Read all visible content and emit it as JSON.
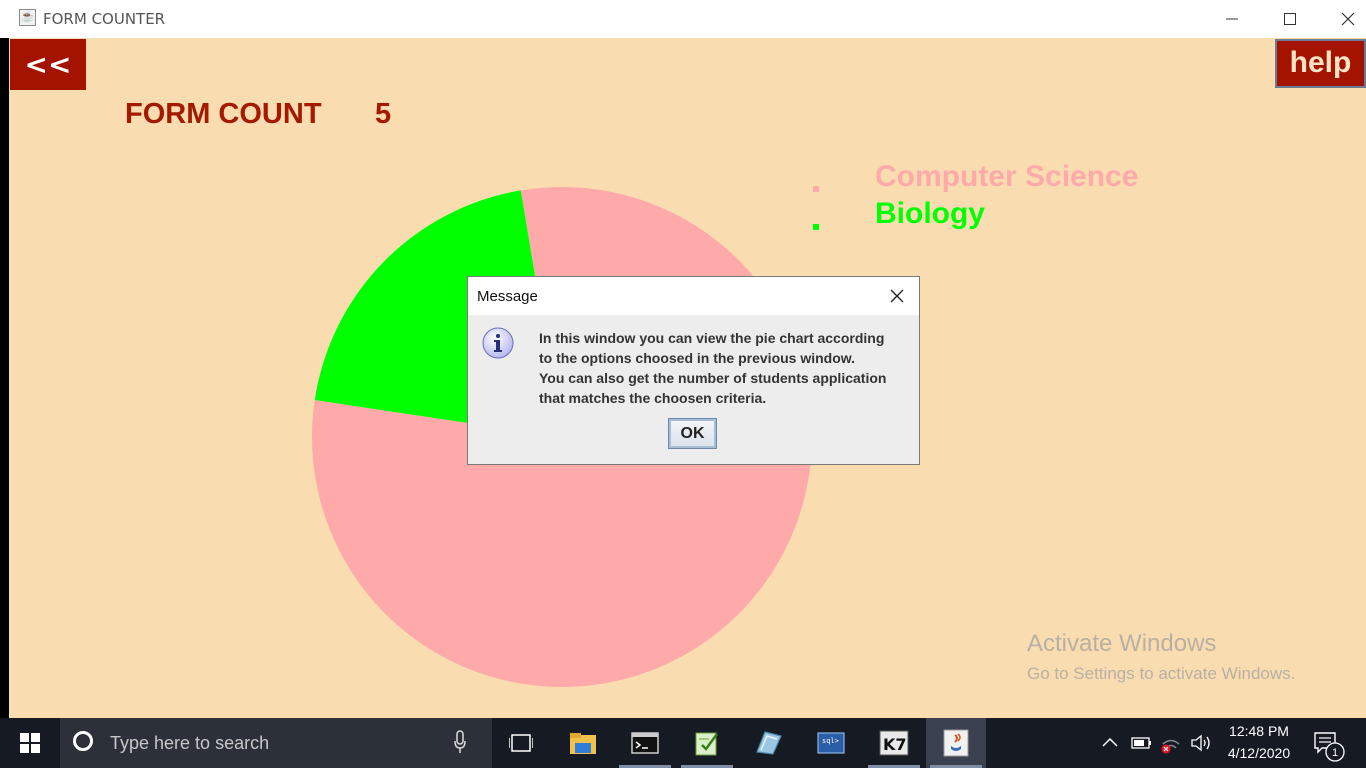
{
  "window": {
    "title": "FORM COUNTER"
  },
  "buttons": {
    "back": "<<",
    "help": "help"
  },
  "form_count": {
    "label": "FORM COUNT",
    "value": "5"
  },
  "legend": [
    {
      "label": "Computer Science",
      "color": "#ffaaaa"
    },
    {
      "label": "Biology",
      "color": "#00ff00"
    }
  ],
  "chart_data": {
    "type": "pie",
    "slices": [
      {
        "label": "Computer Science",
        "fraction": 0.8,
        "color": "#ffaaaa"
      },
      {
        "label": "Biology",
        "fraction": 0.2,
        "color": "#00ff00"
      }
    ]
  },
  "dialog": {
    "title": "Message",
    "lines": [
      "In this window you can view the pie chart according",
      "to the options choosed in the previous window.",
      "You can also get the number of students application",
      "that matches the choosen criteria."
    ],
    "ok": "OK"
  },
  "watermark": {
    "line1": "Activate Windows",
    "line2": "Go to Settings to activate Windows."
  },
  "taskbar": {
    "search_placeholder": "Type here to search",
    "time": "12:48 PM",
    "date": "4/12/2020",
    "notification_count": "1"
  }
}
